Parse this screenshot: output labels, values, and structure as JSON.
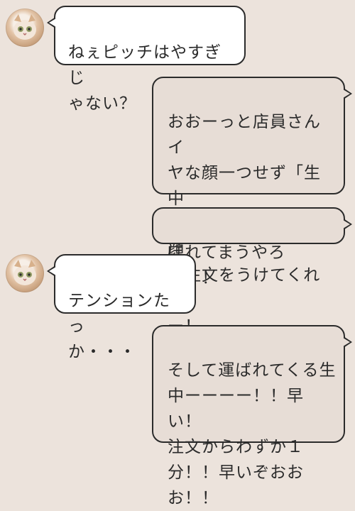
{
  "messages": [
    {
      "sender": "friend",
      "text": "ねぇピッチはやすぎじ\nゃない？"
    },
    {
      "sender": "me",
      "text": "おおーっと店員さんイ\nヤな顔一つせず「生中\n１つですね！」と笑顔\nで注文をうけてくれる\nー！"
    },
    {
      "sender": "me",
      "text": "ほれてまうやろー！！"
    },
    {
      "sender": "friend",
      "text": "テンションたっ\nか・・・"
    },
    {
      "sender": "me",
      "text": "そして運ばれてくる生\n中ーーーー！！早い！\n注文からわずか１\n分！！早いぞおお\nお！！"
    }
  ],
  "colors": {
    "background": "#ece3dc",
    "incoming_bubble": "#ffffff",
    "outgoing_bubble": "#e7ddd6",
    "bubble_border": "#2b2b2b"
  },
  "icons": {
    "friend_avatar": "cat-avatar-icon"
  }
}
